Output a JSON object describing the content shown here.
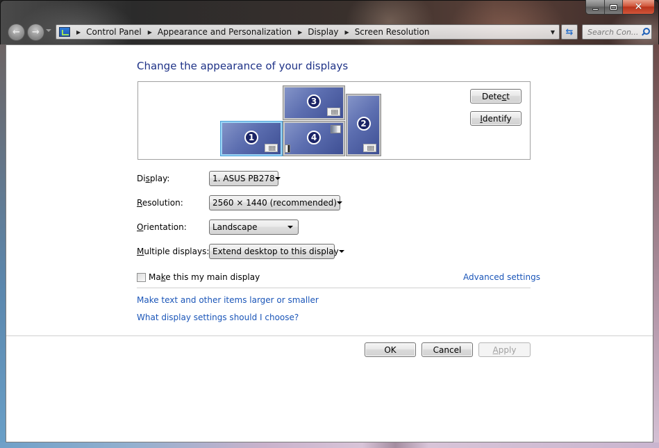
{
  "window": {
    "caption_buttons": {
      "minimize": "minimize",
      "maximize": "maximize",
      "close": "close"
    }
  },
  "nav": {
    "back_icon": "back-arrow-icon",
    "forward_icon": "forward-arrow-icon",
    "recent_pages_icon": "chevron-down-icon"
  },
  "address_bar": {
    "icon": "control-panel-icon",
    "breadcrumbs": [
      "Control Panel",
      "Appearance and Personalization",
      "Display",
      "Screen Resolution"
    ],
    "refresh_icon": "refresh-icon"
  },
  "search": {
    "placeholder": "Search Con..."
  },
  "page": {
    "title": "Change the appearance of your displays",
    "monitors": [
      {
        "number": "1",
        "selected": true,
        "icons": [
          "keypad-icon"
        ]
      },
      {
        "number": "2",
        "selected": false,
        "icons": [
          "keypad-icon"
        ]
      },
      {
        "number": "3",
        "selected": false,
        "icons": [
          "keypad-icon"
        ]
      },
      {
        "number": "4",
        "selected": false,
        "icons": [
          "gadget-icon",
          "taskbar-icon"
        ]
      }
    ],
    "detect_button": {
      "pre": "Dete",
      "accel": "c",
      "post": "t"
    },
    "identify_button": {
      "pre": "",
      "accel": "I",
      "post": "dentify"
    },
    "fields": {
      "display": {
        "label_pre": "Di",
        "label_accel": "s",
        "label_post": "play:",
        "value": "1. ASUS PB278"
      },
      "resolution": {
        "label_pre": "",
        "label_accel": "R",
        "label_post": "esolution:",
        "value": "2560 × 1440 (recommended)"
      },
      "orientation": {
        "label_pre": "",
        "label_accel": "O",
        "label_post": "rientation:",
        "value": "Landscape"
      },
      "multiple_displays": {
        "label_pre": "",
        "label_accel": "M",
        "label_post": "ultiple displays:",
        "value": "Extend desktop to this display"
      }
    },
    "main_display_checkbox": {
      "checked": false,
      "label_pre": "Ma",
      "label_accel": "k",
      "label_post": "e this my main display"
    },
    "advanced_settings_link": "Advanced settings",
    "links": [
      "Make text and other items larger or smaller",
      "What display settings should I choose?"
    ],
    "ok_button": "OK",
    "cancel_button": "Cancel",
    "apply_button": {
      "accel": "A",
      "post": "pply",
      "disabled": true
    }
  }
}
